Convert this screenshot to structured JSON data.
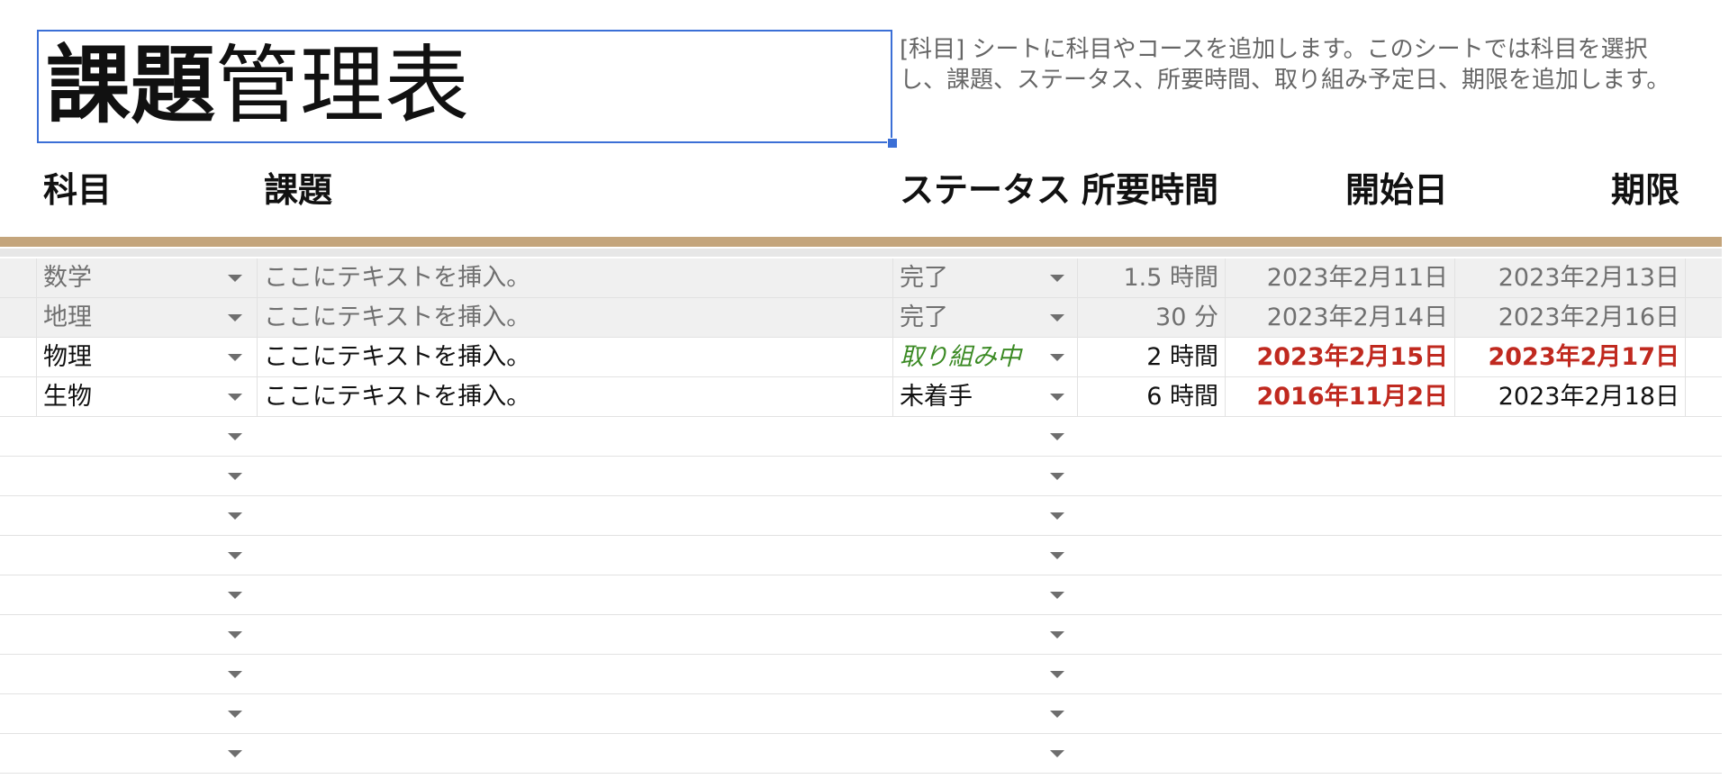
{
  "title": {
    "bold": "課題",
    "normal": "管理表"
  },
  "description": "[科目] シートに科目やコースを追加します。このシートでは科目を選択し、課題、ステータス、所要時間、取り組み予定日、期限を追加します。",
  "headers": {
    "subject": "科目",
    "task": "課題",
    "status": "ステータス",
    "time": "所要時間",
    "start": "開始日",
    "due": "期限"
  },
  "rows": [
    {
      "subject": "数学",
      "task": "ここにテキストを挿入。",
      "status": "完了",
      "time": "1.5 時間",
      "start": "2023年2月11日",
      "due": "2023年2月13日"
    },
    {
      "subject": "地理",
      "task": "ここにテキストを挿入。",
      "status": "完了",
      "time": "30 分",
      "start": "2023年2月14日",
      "due": "2023年2月16日"
    },
    {
      "subject": "物理",
      "task": "ここにテキストを挿入。",
      "status": "取り組み中",
      "time": "2 時間",
      "start": "2023年2月15日",
      "due": "2023年2月17日"
    },
    {
      "subject": "生物",
      "task": "ここにテキストを挿入。",
      "status": "未着手",
      "time": "6 時間",
      "start": "2016年11月2日",
      "due": "2023年2月18日"
    }
  ],
  "colors": {
    "accent_rule": "#c4a57c",
    "overdue": "#c0291f",
    "in_progress": "#3b8a24",
    "selection": "#3b6fd6"
  }
}
